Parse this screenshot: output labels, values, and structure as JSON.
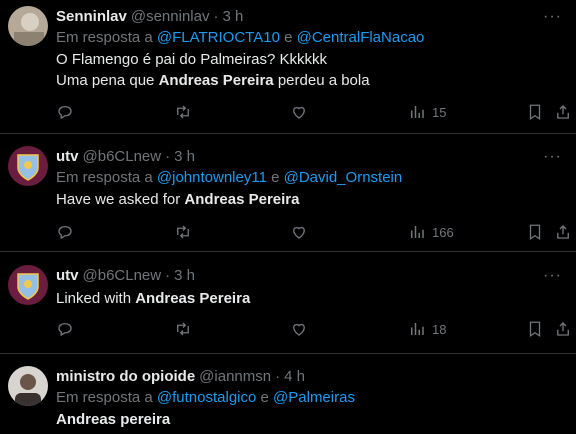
{
  "tweets": [
    {
      "name": "Senninlav",
      "handle": "@senninlav",
      "sep": "·",
      "time": "3 h",
      "reply_prefix": "Em resposta a",
      "reply_m1": "@FLATRIOCTA10",
      "reply_and": "e",
      "reply_m2": "@CentralFlaNacao",
      "line1": "O Flamengo é pai do Palmeiras? Kkkkkk",
      "line2_a": "Uma pena que",
      "line2_b": "Andreas Pereira",
      "line2_c": "perdeu a bola",
      "views": "15"
    },
    {
      "name": "utv",
      "handle": "@b6CLnew",
      "sep": "·",
      "time": "3 h",
      "reply_prefix": "Em resposta a",
      "reply_m1": "@johntownley11",
      "reply_and": "e",
      "reply_m2": "@David_Ornstein",
      "text_a": "Have we asked for",
      "text_b": "Andreas Pereira",
      "views": "166"
    },
    {
      "name": "utv",
      "handle": "@b6CLnew",
      "sep": "·",
      "time": "3 h",
      "text_a": "Linked with",
      "text_b": "Andreas Pereira",
      "views": "18"
    },
    {
      "name": "ministro do opioide",
      "handle": "@iannmsn",
      "sep": "·",
      "time": "4 h",
      "reply_prefix": "Em resposta a",
      "reply_m1": "@futnostalgico",
      "reply_and": "e",
      "reply_m2": "@Palmeiras",
      "text_b": "Andreas pereira"
    }
  ],
  "more_label": "···",
  "colors": {
    "accent": "#1d9bf0",
    "muted": "#71767b",
    "border": "#2f3336",
    "background": "#000000"
  },
  "icons": [
    "reply-icon",
    "retweet-icon",
    "like-icon",
    "views-icon",
    "bookmark-icon",
    "share-icon",
    "more-icon"
  ]
}
